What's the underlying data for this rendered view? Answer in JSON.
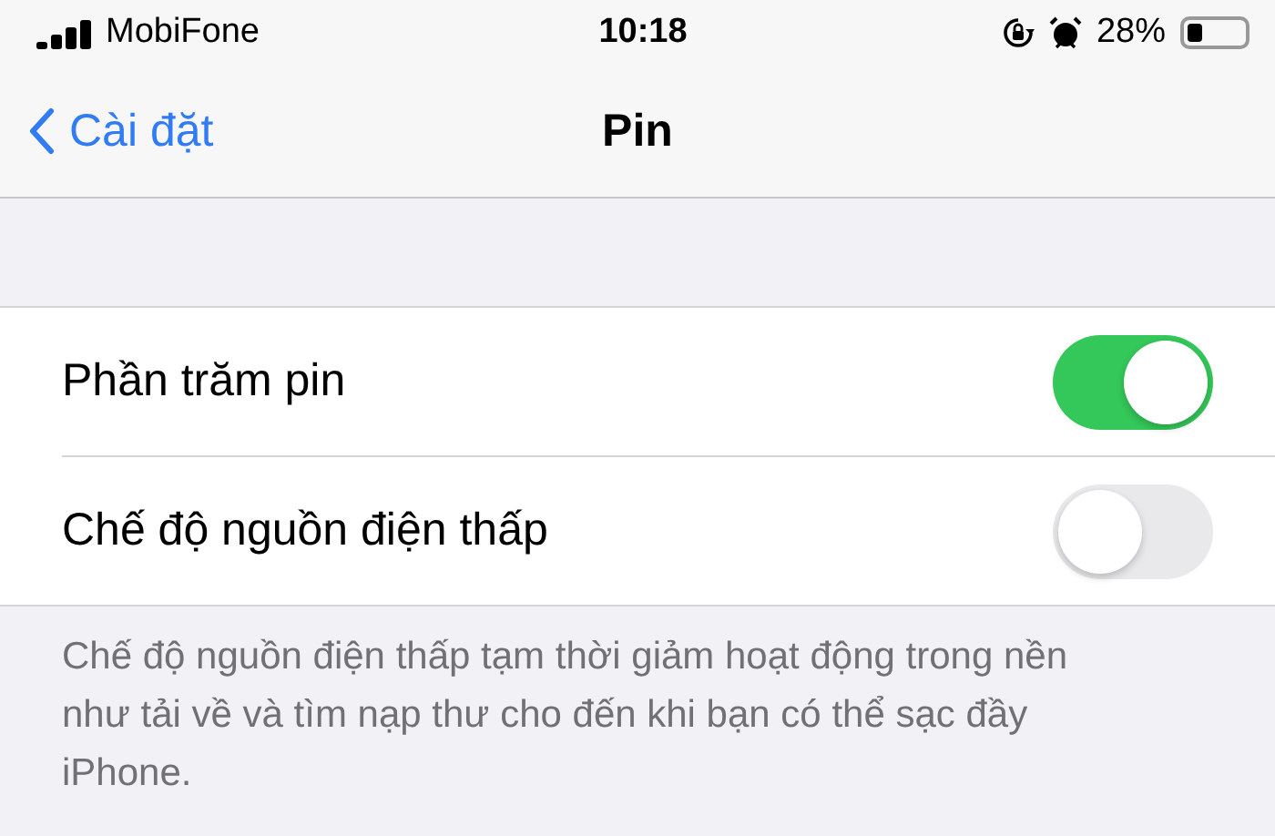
{
  "status_bar": {
    "carrier": "MobiFone",
    "time": "10:18",
    "battery_percent": "28%"
  },
  "nav": {
    "back": "Cài đặt",
    "title": "Pin"
  },
  "settings": [
    {
      "label": "Phần trăm pin",
      "on": true
    },
    {
      "label": "Chế độ nguồn điện thấp",
      "on": false
    }
  ],
  "footer": "Chế độ nguồn điện thấp tạm thời giảm hoạt động trong nền như tải về và tìm nạp thư cho đến khi bạn có thể sạc đầy iPhone."
}
